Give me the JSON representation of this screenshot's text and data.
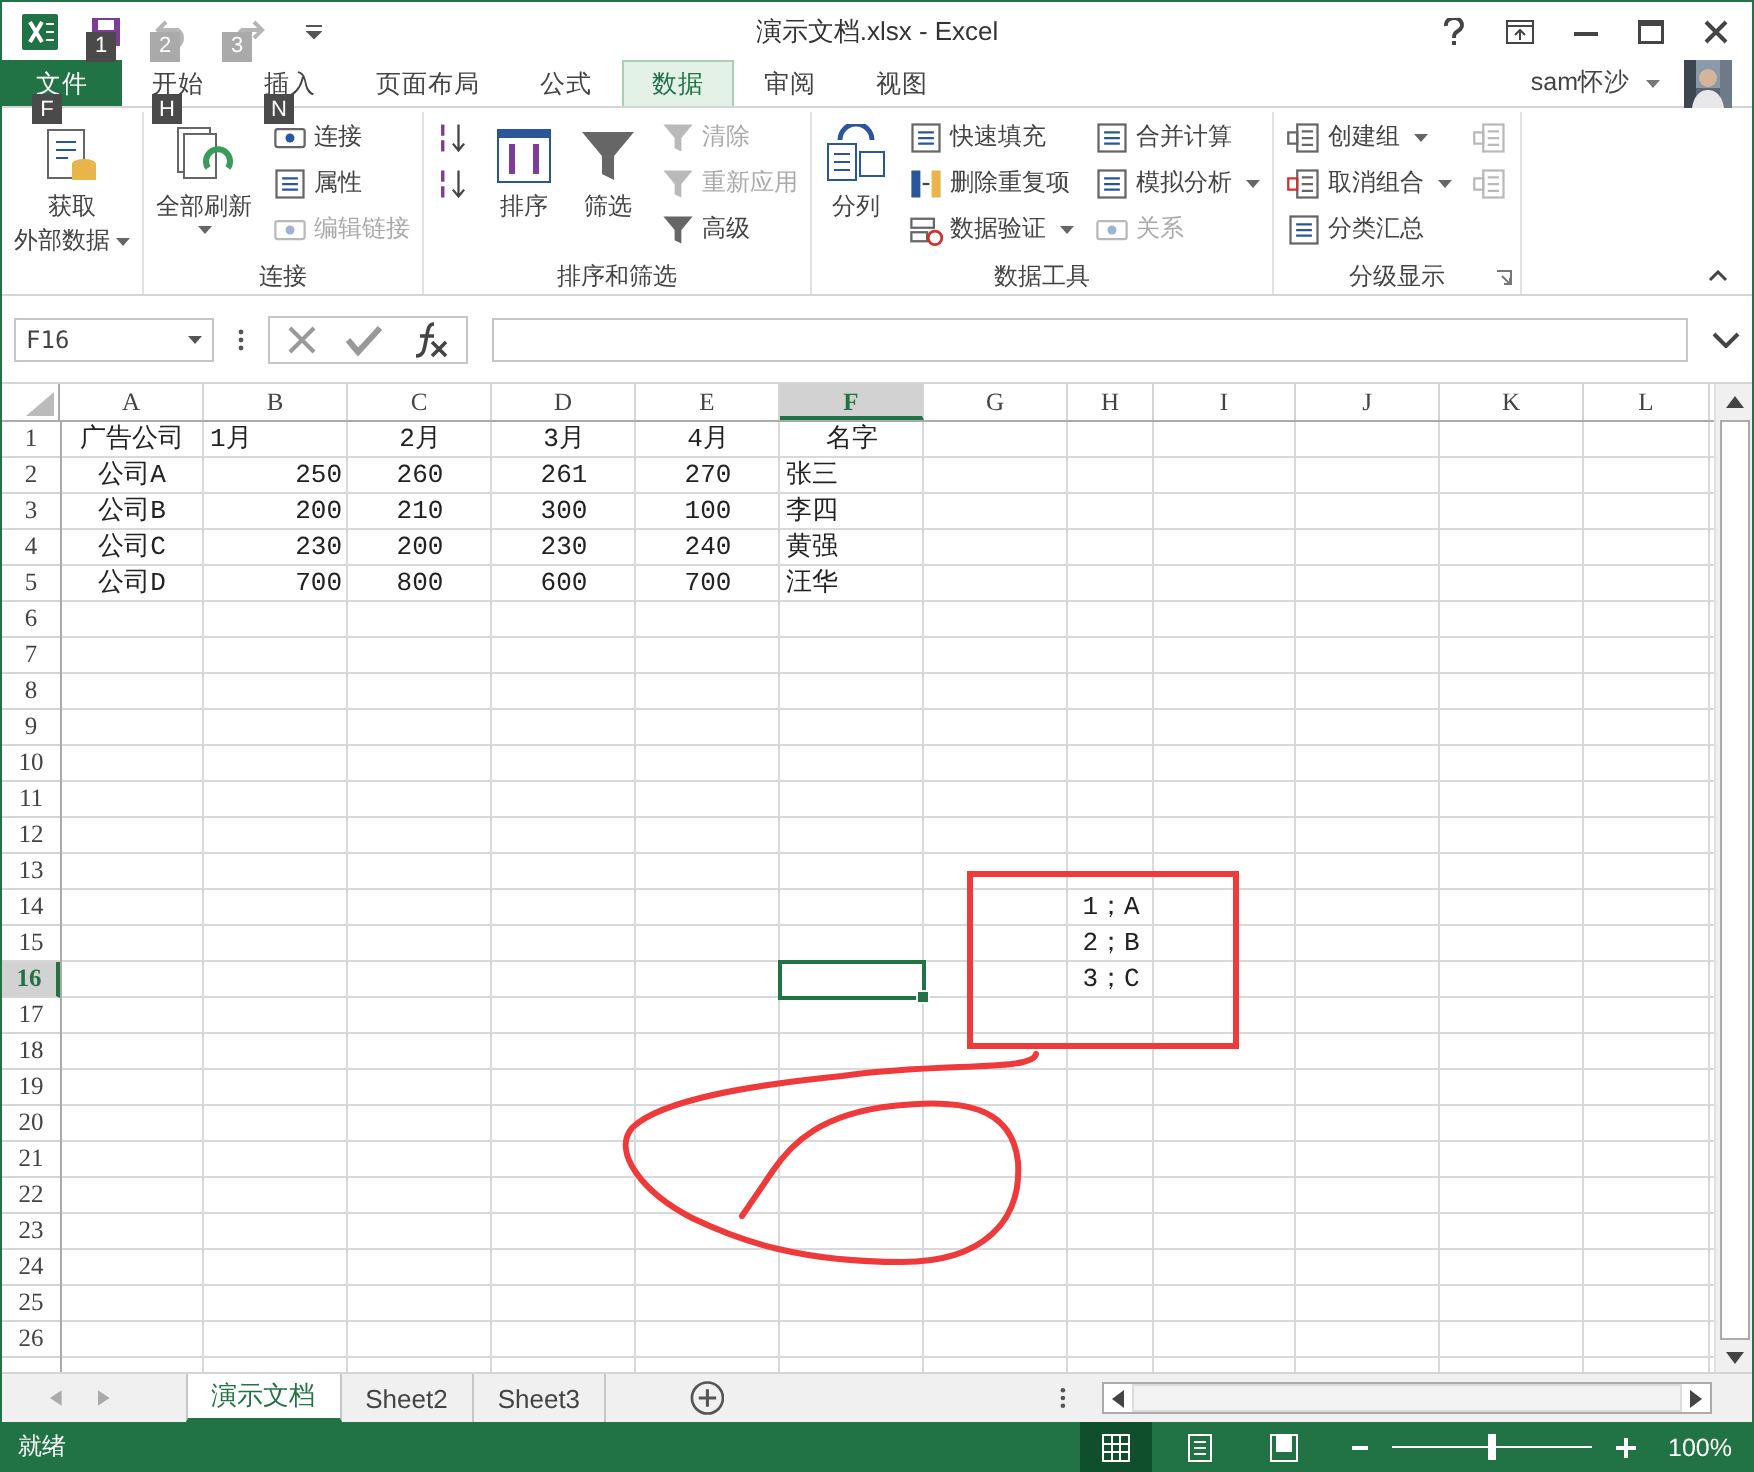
{
  "window": {
    "title": "演示文档.xlsx - Excel"
  },
  "quick_access": [
    {
      "keytip": "1",
      "disabled": false
    },
    {
      "keytip": "2",
      "disabled": true
    },
    {
      "keytip": "3",
      "disabled": true
    }
  ],
  "tabs": [
    {
      "label": "文件",
      "kind": "file",
      "selected": false,
      "keytip": "F"
    },
    {
      "label": "开始",
      "kind": "tab",
      "selected": false,
      "keytip": "H"
    },
    {
      "label": "插入",
      "kind": "tab",
      "selected": false,
      "keytip": "N"
    },
    {
      "label": "页面布局",
      "kind": "tab",
      "selected": false
    },
    {
      "label": "公式",
      "kind": "tab",
      "selected": false
    },
    {
      "label": "数据",
      "kind": "tab",
      "selected": true
    },
    {
      "label": "审阅",
      "kind": "tab",
      "selected": false
    },
    {
      "label": "视图",
      "kind": "tab",
      "selected": false
    }
  ],
  "user": {
    "name": "sam怀沙"
  },
  "ribbon": {
    "groups": [
      {
        "columns": [
          [
            {
              "kind": "large",
              "lines": [
                "获取",
                "外部数据"
              ],
              "disabled": false,
              "dropdown": true
            }
          ]
        ]
      },
      {
        "label": "连接",
        "columns": [
          [
            {
              "kind": "large",
              "label": "全部刷新",
              "disabled": false,
              "dropdown": true
            }
          ],
          [
            {
              "kind": "small",
              "label": "连接",
              "disabled": false,
              "dropdown": false
            },
            {
              "kind": "small",
              "label": "属性",
              "disabled": false,
              "dropdown": false
            },
            {
              "kind": "small",
              "label": "编辑链接",
              "disabled": true,
              "dropdown": false
            }
          ]
        ]
      },
      {
        "label": "排序和筛选",
        "columns": [
          [
            {
              "kind": "small",
              "disabled": false,
              "dropdown": false
            },
            {
              "kind": "small",
              "disabled": false,
              "dropdown": false
            }
          ],
          [
            {
              "kind": "large",
              "label": "排序",
              "disabled": false,
              "dropdown": false
            }
          ],
          [
            {
              "kind": "large",
              "label": "筛选",
              "disabled": false,
              "dropdown": false
            }
          ],
          [
            {
              "kind": "small",
              "label": "清除",
              "disabled": true,
              "dropdown": false
            },
            {
              "kind": "small",
              "label": "重新应用",
              "disabled": true,
              "dropdown": false
            },
            {
              "kind": "small",
              "label": "高级",
              "disabled": false,
              "dropdown": false
            }
          ]
        ]
      },
      {
        "label": "数据工具",
        "columns": [
          [
            {
              "kind": "large",
              "label": "分列",
              "disabled": false,
              "dropdown": false
            }
          ],
          [
            {
              "kind": "small",
              "label": "快速填充",
              "disabled": false,
              "dropdown": false
            },
            {
              "kind": "small",
              "label": "删除重复项",
              "disabled": false,
              "dropdown": false
            },
            {
              "kind": "small",
              "label": "数据验证",
              "disabled": false,
              "dropdown": true
            }
          ],
          [
            {
              "kind": "small",
              "label": "合并计算",
              "disabled": false,
              "dropdown": false
            },
            {
              "kind": "small",
              "label": "模拟分析",
              "disabled": false,
              "dropdown": true
            },
            {
              "kind": "small",
              "label": "关系",
              "disabled": true,
              "dropdown": false
            }
          ]
        ]
      },
      {
        "label": "分级显示",
        "columns": [
          [
            {
              "kind": "small",
              "label": "创建组",
              "disabled": false,
              "dropdown": true
            },
            {
              "kind": "small",
              "label": "取消组合",
              "disabled": false,
              "dropdown": true
            },
            {
              "kind": "small",
              "label": "分类汇总",
              "disabled": false,
              "dropdown": false
            }
          ],
          [
            {
              "kind": "small",
              "disabled": true,
              "dropdown": false
            },
            {
              "kind": "small",
              "disabled": true,
              "dropdown": false
            }
          ]
        ],
        "launcher": true
      }
    ]
  },
  "formula_bar": {
    "name_box": "F16"
  },
  "sheet": {
    "columns": [
      {
        "label": "A",
        "selected": false
      },
      {
        "label": "B",
        "selected": false
      },
      {
        "label": "C",
        "selected": false
      },
      {
        "label": "D",
        "selected": false
      },
      {
        "label": "E",
        "selected": false
      },
      {
        "label": "F",
        "selected": true
      },
      {
        "label": "G",
        "selected": false
      },
      {
        "label": "H",
        "selected": false
      },
      {
        "label": "I",
        "selected": false
      },
      {
        "label": "J",
        "selected": false
      },
      {
        "label": "K",
        "selected": false
      },
      {
        "label": "L",
        "selected": false
      }
    ],
    "rows": [
      {
        "label": "1",
        "selected": false,
        "cells": {
          "A": "广告公司",
          "B": "1月",
          "C": "2月",
          "D": "3月",
          "E": "4月",
          "F": "名字"
        }
      },
      {
        "label": "2",
        "selected": false,
        "cells": {
          "A": "公司A",
          "B": "250",
          "C": "260",
          "D": "261",
          "E": "270",
          "F": "张三"
        }
      },
      {
        "label": "3",
        "selected": false,
        "cells": {
          "A": "公司B",
          "B": "200",
          "C": "210",
          "D": "300",
          "E": "100",
          "F": "李四"
        }
      },
      {
        "label": "4",
        "selected": false,
        "cells": {
          "A": "公司C",
          "B": "230",
          "C": "200",
          "D": "230",
          "E": "240",
          "F": "黄强"
        }
      },
      {
        "label": "5",
        "selected": false,
        "cells": {
          "A": "公司D",
          "B": "700",
          "C": "800",
          "D": "600",
          "E": "700",
          "F": "汪华"
        }
      },
      {
        "label": "6",
        "selected": false
      },
      {
        "label": "7",
        "selected": false
      },
      {
        "label": "8",
        "selected": false
      },
      {
        "label": "9",
        "selected": false
      },
      {
        "label": "10",
        "selected": false
      },
      {
        "label": "11",
        "selected": false
      },
      {
        "label": "12",
        "selected": false
      },
      {
        "label": "13",
        "selected": false
      },
      {
        "label": "14",
        "selected": false,
        "cells": {
          "H": "1；A"
        }
      },
      {
        "label": "15",
        "selected": false,
        "cells": {
          "H": "2；B"
        }
      },
      {
        "label": "16",
        "selected": true,
        "cells": {
          "H": "3；C"
        }
      },
      {
        "label": "17",
        "selected": false
      },
      {
        "label": "18",
        "selected": false
      },
      {
        "label": "19",
        "selected": false
      },
      {
        "label": "20",
        "selected": false
      },
      {
        "label": "21",
        "selected": false
      },
      {
        "label": "22",
        "selected": false
      },
      {
        "label": "23",
        "selected": false
      },
      {
        "label": "24",
        "selected": false
      },
      {
        "label": "25",
        "selected": false
      },
      {
        "label": "26",
        "selected": false
      }
    ]
  },
  "markup": {
    "box": true,
    "loop": true
  },
  "sheet_tabs": [
    {
      "label": "演示文档",
      "selected": true
    },
    {
      "label": "Sheet2",
      "selected": false
    },
    {
      "label": "Sheet3",
      "selected": false
    }
  ],
  "status_bar": {
    "text": "就绪",
    "views": [
      {
        "selected": true
      },
      {
        "selected": false
      },
      {
        "selected": false
      }
    ],
    "zoom": {
      "level": 0.5,
      "reading": "100%"
    }
  }
}
